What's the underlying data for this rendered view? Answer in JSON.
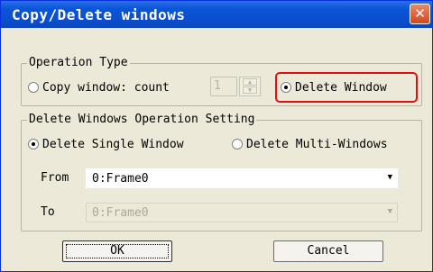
{
  "window": {
    "title": "Copy/Delete windows",
    "close_glyph": "✕"
  },
  "operation_type": {
    "legend": "Operation Type",
    "copy_label": "Copy window: count",
    "copy_checked": false,
    "count_value": "1",
    "delete_label": "Delete Window",
    "delete_checked": true,
    "highlight_color": "#e01010"
  },
  "delete_settings": {
    "legend": "Delete Windows Operation Setting",
    "single_label": "Delete Single Window",
    "single_checked": true,
    "multi_label": "Delete Multi-Windows",
    "multi_checked": false,
    "from_label": "From",
    "from_value": "0:Frame0",
    "to_label": "To",
    "to_value": "0:Frame0"
  },
  "buttons": {
    "ok": "OK",
    "cancel": "Cancel"
  },
  "icons": {
    "close": "close-icon",
    "dropdown": "chevron-down-icon",
    "spinner_up": "arrow-up-icon",
    "spinner_down": "arrow-down-icon"
  }
}
